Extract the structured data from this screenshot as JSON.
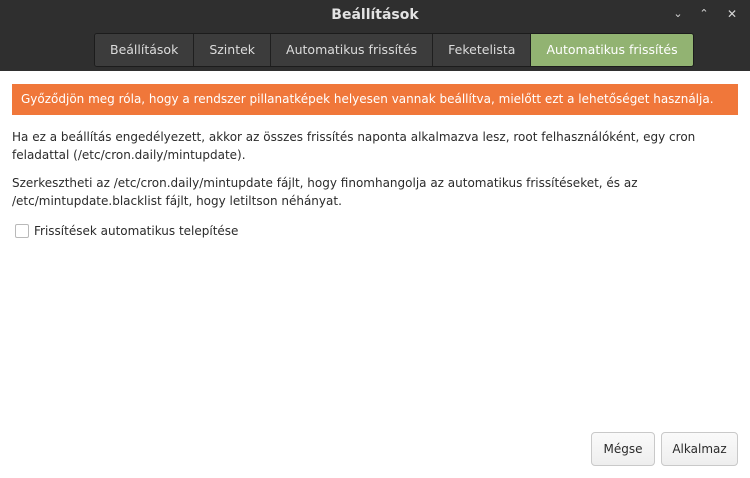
{
  "window": {
    "title": "Beállítások",
    "controls": {
      "minimize": "⌄",
      "maximize": "⌃",
      "close": "✕"
    }
  },
  "tabs": [
    {
      "label": "Beállítások",
      "active": false
    },
    {
      "label": "Szintek",
      "active": false
    },
    {
      "label": "Automatikus frissítés",
      "active": false
    },
    {
      "label": "Feketelista",
      "active": false
    },
    {
      "label": "Automatikus frissítés",
      "active": true
    }
  ],
  "banner": {
    "text": "Győződjön meg róla, hogy a rendszer pillanatképek helyesen vannak beállítva, mielőtt ezt a lehetőséget használja.",
    "color": "#f0773a"
  },
  "content": {
    "paragraph1": "Ha ez a beállítás engedélyezett, akkor az összes frissítés naponta alkalmazva lesz, root felhasználóként, egy cron feladattal (/etc/cron.daily/mintupdate).",
    "paragraph2": "Szerkesztheti az /etc/cron.daily/mintupdate fájlt, hogy finomhangolja az automatikus frissítéseket, és az /etc/mintupdate.blacklist fájlt, hogy letiltson néhányat.",
    "checkbox": {
      "label": "Frissítések automatikus telepítése",
      "checked": false
    }
  },
  "buttons": {
    "cancel": "Mégse",
    "apply": "Alkalmaz"
  },
  "colors": {
    "header": "#2f2f2f",
    "active_tab": "#92b372"
  }
}
